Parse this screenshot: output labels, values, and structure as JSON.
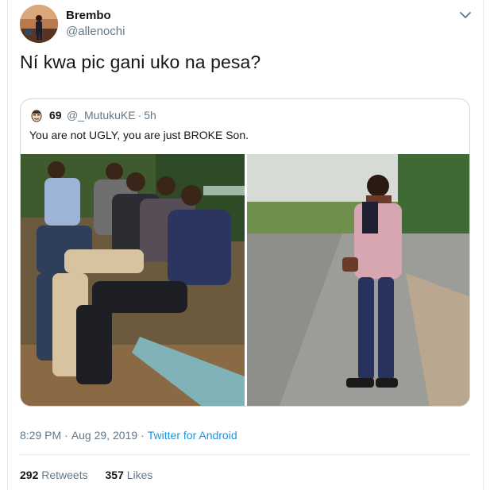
{
  "author": {
    "display_name": "Brembo",
    "handle": "@allenochi"
  },
  "tweet": {
    "text": "Ní kwa pic gani uko na pesa?"
  },
  "quoted_tweet": {
    "author_name": "69",
    "author_handle": "@_MutukuKE",
    "age": "5h",
    "text": "You are not UGLY, you are just BROKE Son."
  },
  "meta": {
    "time": "8:29 PM",
    "date": "Aug 29, 2019",
    "separator": "·",
    "source": "Twitter for Android"
  },
  "stats": {
    "retweets_count": "292",
    "retweets_label": "Retweets",
    "likes_count": "357",
    "likes_label": "Likes"
  },
  "icons": {
    "menu_caret": "chevron-down-icon",
    "quote_avatar": "face-emoji-icon"
  },
  "colors": {
    "link": "#1b95e0",
    "secondary_text": "#657786",
    "primary_text": "#14171a",
    "border": "#ccd6dd"
  }
}
